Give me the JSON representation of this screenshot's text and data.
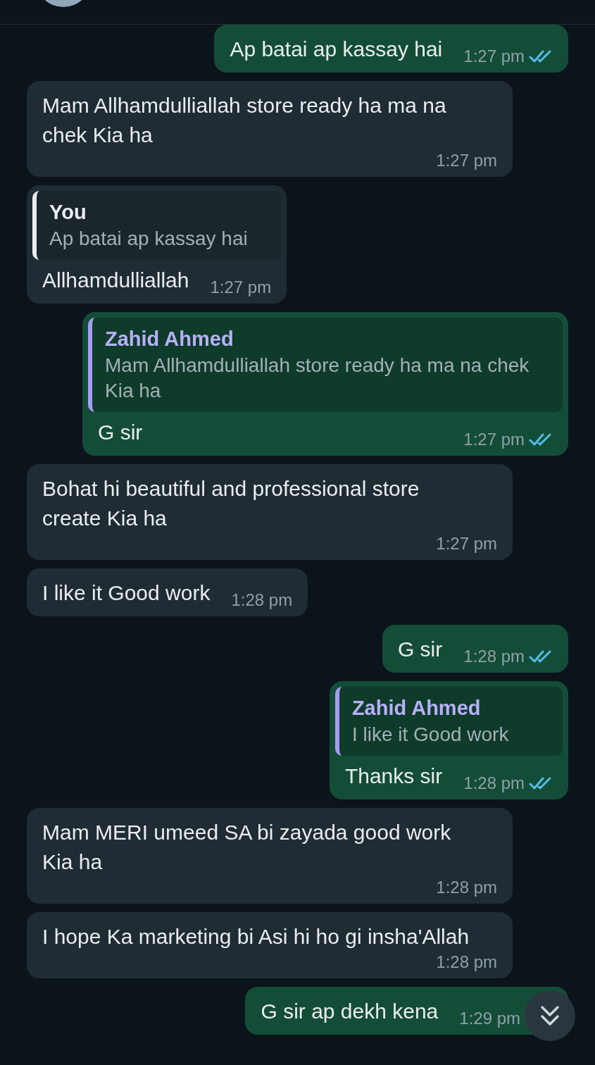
{
  "messages": [
    {
      "kind": "outgoing",
      "text": "Ap batai ap kassay hai",
      "time": "1:27 pm",
      "read": true
    },
    {
      "kind": "incoming",
      "text": "Mam Allhamdulliallah store ready ha ma na chek Kia ha",
      "time": "1:27 pm"
    },
    {
      "kind": "incoming",
      "quote": {
        "author": "You",
        "text": "Ap batai ap kassay hai",
        "mine": true
      },
      "text": "Allhamdulliallah",
      "time": "1:27 pm"
    },
    {
      "kind": "outgoing",
      "quote": {
        "author": "Zahid Ahmed",
        "text": "Mam Allhamdulliallah store ready ha ma na chek Kia ha",
        "mine": false
      },
      "text": "G sir",
      "time": "1:27 pm",
      "read": true
    },
    {
      "kind": "incoming",
      "text": "Bohat hi beautiful and professional store create Kia ha",
      "time": "1:27 pm"
    },
    {
      "kind": "incoming",
      "text": "I like it Good work",
      "time": "1:28 pm"
    },
    {
      "kind": "outgoing",
      "text": "G sir",
      "time": "1:28 pm",
      "read": true
    },
    {
      "kind": "outgoing",
      "quote": {
        "author": "Zahid Ahmed",
        "text": "I like it Good work",
        "mine": false
      },
      "text": "Thanks sir",
      "time": "1:28 pm",
      "read": true
    },
    {
      "kind": "incoming",
      "text": "Mam MERI umeed SA bi zayada good work Kia ha",
      "time": "1:28 pm"
    },
    {
      "kind": "incoming",
      "text": "I hope Ka marketing bi Asi hi ho gi insha'Allah",
      "time": "1:28 pm"
    },
    {
      "kind": "outgoing",
      "text": "G sir ap dekh kena",
      "time": "1:29 pm"
    }
  ]
}
